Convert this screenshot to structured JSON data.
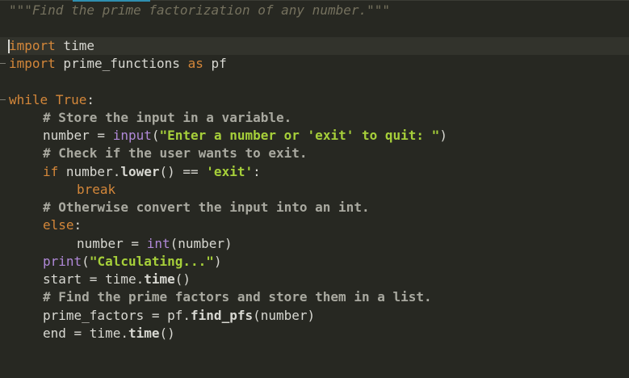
{
  "editor": {
    "accent_color": "#2f8fb0",
    "background_color": "#272822",
    "lines": [
      {
        "id": "doc",
        "tokens": [
          {
            "text": "\"\"\"Find the prime factorization of any number.\"\"\"",
            "kind": "doc"
          }
        ]
      },
      {
        "id": "import-time",
        "tokens": [
          {
            "text": "import",
            "kind": "kw"
          },
          {
            "text": " time",
            "kind": "id"
          }
        ]
      },
      {
        "id": "import-prime",
        "tokens": [
          {
            "text": "import",
            "kind": "kw"
          },
          {
            "text": " prime_functions ",
            "kind": "id"
          },
          {
            "text": "as",
            "kind": "kw"
          },
          {
            "text": " pf",
            "kind": "id"
          }
        ]
      },
      {
        "id": "while",
        "tokens": [
          {
            "text": "while",
            "kind": "kw"
          },
          {
            "text": " ",
            "kind": "id"
          },
          {
            "text": "True",
            "kind": "kw"
          },
          {
            "text": ":",
            "kind": "op"
          }
        ]
      },
      {
        "id": "comment-store",
        "tokens": [
          {
            "text": "# Store the input in a variable.",
            "kind": "comment"
          }
        ]
      },
      {
        "id": "number-input",
        "tokens": [
          {
            "text": "number = ",
            "kind": "id"
          },
          {
            "text": "input",
            "kind": "builtin"
          },
          {
            "text": "(",
            "kind": "op"
          },
          {
            "text": "\"Enter a number or ",
            "kind": "str"
          },
          {
            "text": "'exit'",
            "kind": "str"
          },
          {
            "text": " to quit: \"",
            "kind": "str"
          },
          {
            "text": ")",
            "kind": "op"
          }
        ]
      },
      {
        "id": "comment-check",
        "tokens": [
          {
            "text": "# Check if the user wants to exit.",
            "kind": "comment"
          }
        ]
      },
      {
        "id": "if-exit",
        "tokens": [
          {
            "text": "if",
            "kind": "kw"
          },
          {
            "text": " number.",
            "kind": "id"
          },
          {
            "text": "lower",
            "kind": "fn"
          },
          {
            "text": "() == ",
            "kind": "op"
          },
          {
            "text": "'exit'",
            "kind": "str"
          },
          {
            "text": ":",
            "kind": "op"
          }
        ]
      },
      {
        "id": "break",
        "tokens": [
          {
            "text": "break",
            "kind": "kw"
          }
        ]
      },
      {
        "id": "comment-convert",
        "tokens": [
          {
            "text": "# Otherwise convert the input into an int.",
            "kind": "comment"
          }
        ]
      },
      {
        "id": "else",
        "tokens": [
          {
            "text": "else",
            "kind": "kw"
          },
          {
            "text": ":",
            "kind": "op"
          }
        ]
      },
      {
        "id": "number-int",
        "tokens": [
          {
            "text": "number = ",
            "kind": "id"
          },
          {
            "text": "int",
            "kind": "builtin"
          },
          {
            "text": "(number)",
            "kind": "id"
          }
        ]
      },
      {
        "id": "print-calc",
        "tokens": [
          {
            "text": "print",
            "kind": "builtin"
          },
          {
            "text": "(",
            "kind": "op"
          },
          {
            "text": "\"Calculating...\"",
            "kind": "str"
          },
          {
            "text": ")",
            "kind": "op"
          }
        ]
      },
      {
        "id": "start-time",
        "tokens": [
          {
            "text": "start = time.",
            "kind": "id"
          },
          {
            "text": "time",
            "kind": "fn"
          },
          {
            "text": "()",
            "kind": "op"
          }
        ]
      },
      {
        "id": "comment-find",
        "tokens": [
          {
            "text": "# Find the prime factors and store them in a list.",
            "kind": "comment"
          }
        ]
      },
      {
        "id": "prime-factors",
        "tokens": [
          {
            "text": "prime_factors = pf.",
            "kind": "id"
          },
          {
            "text": "find_pfs",
            "kind": "fn"
          },
          {
            "text": "(number)",
            "kind": "id"
          }
        ]
      },
      {
        "id": "end-time",
        "tokens": [
          {
            "text": "end = time.",
            "kind": "id"
          },
          {
            "text": "time",
            "kind": "fn"
          },
          {
            "text": "()",
            "kind": "op"
          }
        ]
      }
    ]
  }
}
